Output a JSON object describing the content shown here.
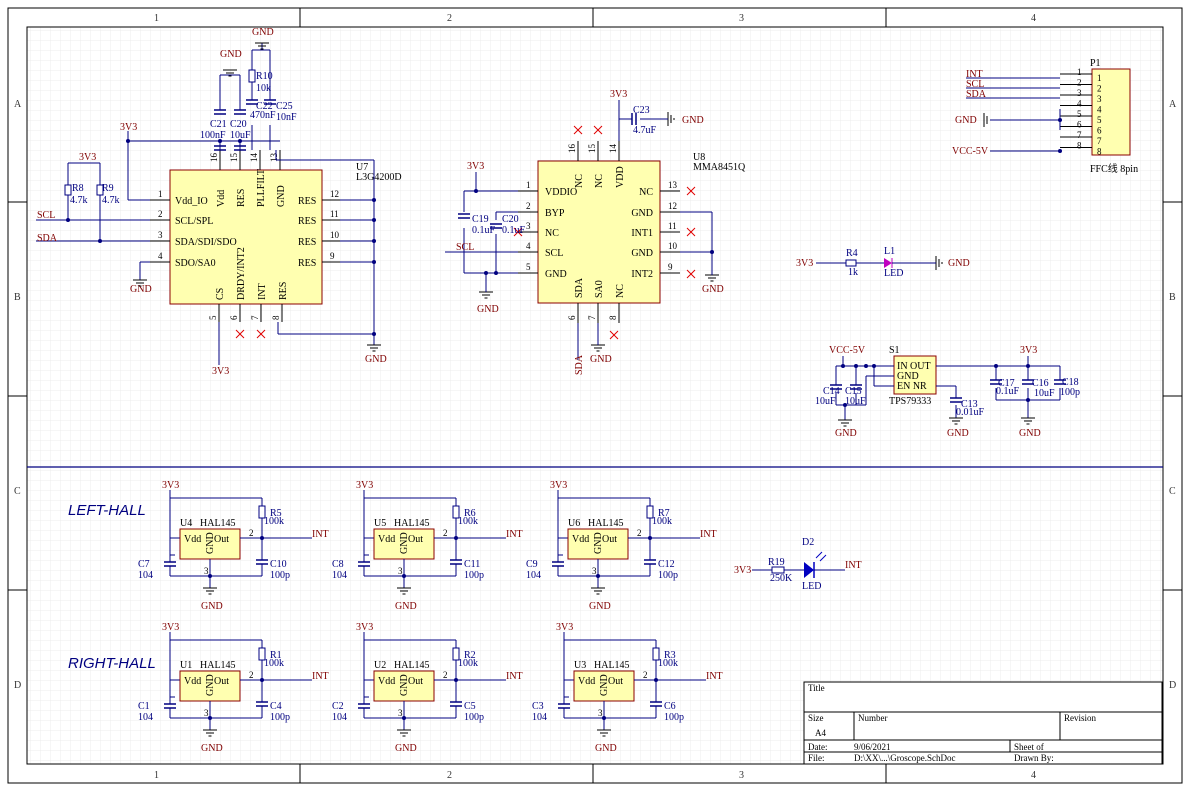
{
  "frame": {
    "cols": [
      "1",
      "2",
      "3",
      "4"
    ],
    "rows": [
      "A",
      "B",
      "C",
      "D"
    ]
  },
  "sections": {
    "left_hall": "LEFT-HALL",
    "right_hall": "RIGHT-HALL"
  },
  "nets": {
    "v3": "3V3",
    "gnd": "GND",
    "scl": "SCL",
    "sda": "SDA",
    "int": "INT",
    "vcc5": "VCC-5V"
  },
  "u7": {
    "ref": "U7",
    "part": "L3G4200D",
    "left_pins": [
      {
        "num": "1",
        "name": "Vdd_IO"
      },
      {
        "num": "2",
        "name": "SCL/SPL"
      },
      {
        "num": "3",
        "name": "SDA/SDI/SDO"
      },
      {
        "num": "4",
        "name": "SDO/SA0"
      }
    ],
    "right_pins": [
      {
        "num": "12",
        "name": "RES"
      },
      {
        "num": "11",
        "name": "RES"
      },
      {
        "num": "10",
        "name": "RES"
      },
      {
        "num": "9",
        "name": "RES"
      }
    ],
    "top_pins": [
      {
        "num": "16",
        "name": "Vdd"
      },
      {
        "num": "15",
        "name": "RES"
      },
      {
        "num": "14",
        "name": "PLLFILT"
      },
      {
        "num": "13",
        "name": "GND"
      }
    ],
    "bottom_pins": [
      {
        "num": "5",
        "name": "CS"
      },
      {
        "num": "6",
        "name": "DRDY/INT2"
      },
      {
        "num": "7",
        "name": "INT"
      },
      {
        "num": "8",
        "name": "RES"
      }
    ]
  },
  "u8": {
    "ref": "U8",
    "part": "MMA8451Q",
    "left_pins": [
      {
        "num": "1",
        "name": "VDDIO"
      },
      {
        "num": "2",
        "name": "BYP"
      },
      {
        "num": "3",
        "name": "NC"
      },
      {
        "num": "4",
        "name": "SCL"
      },
      {
        "num": "5",
        "name": "GND"
      }
    ],
    "right_pins": [
      {
        "num": "13",
        "name": "NC"
      },
      {
        "num": "12",
        "name": "GND"
      },
      {
        "num": "11",
        "name": "INT1"
      },
      {
        "num": "10",
        "name": "GND"
      },
      {
        "num": "9",
        "name": "INT2"
      }
    ],
    "top_pins": [
      {
        "num": "16",
        "name": "NC"
      },
      {
        "num": "15",
        "name": "NC"
      },
      {
        "num": "14",
        "name": "VDD"
      }
    ],
    "bottom_pins": [
      {
        "num": "6",
        "name": "SDA"
      },
      {
        "num": "7",
        "name": "SA0"
      },
      {
        "num": "8",
        "name": "NC"
      }
    ]
  },
  "passives": {
    "r8": {
      "ref": "R8",
      "val": "4.7k"
    },
    "r9": {
      "ref": "R9",
      "val": "4.7k"
    },
    "r10": {
      "ref": "R10",
      "val": "10k"
    },
    "c21": {
      "ref": "C21",
      "val": "100nF"
    },
    "c20": {
      "ref": "C20",
      "val": "10uF"
    },
    "c22": {
      "ref": "C22",
      "val": "470nF"
    },
    "c25": {
      "ref": "C25",
      "val": "10nF"
    },
    "c23": {
      "ref": "C23",
      "val": "4.7uF"
    },
    "c19": {
      "ref": "C19",
      "val": "0.1uF"
    },
    "c20b": {
      "ref": "C20",
      "val": "0.1uF"
    },
    "r4": {
      "ref": "R4",
      "val": "1k"
    },
    "l1": {
      "ref": "L1",
      "val": "LED"
    },
    "c14": {
      "ref": "C14",
      "val": "10uF"
    },
    "c15": {
      "ref": "C15",
      "val": "10uF"
    },
    "c13": {
      "ref": "C13",
      "val": "0.01uF"
    },
    "c17": {
      "ref": "C17",
      "val": "0.1uF"
    },
    "c16": {
      "ref": "C16",
      "val": "10uF"
    },
    "c18": {
      "ref": "C18",
      "val": "100p"
    },
    "r19": {
      "ref": "R19",
      "val": "250K"
    },
    "d2": {
      "ref": "D2",
      "val": "LED"
    }
  },
  "s1": {
    "ref": "S1",
    "part": "TPS79333",
    "pins": [
      "IN OUT",
      "GND",
      "EN  NR"
    ]
  },
  "p1": {
    "ref": "P1",
    "part": "FFC线 8pin",
    "nets": [
      "INT",
      "SCL",
      "SDA",
      "",
      "GND",
      "",
      "",
      "VCC-5V"
    ],
    "pins": [
      "1",
      "2",
      "3",
      "4",
      "5",
      "6",
      "7",
      "8"
    ]
  },
  "halls": [
    {
      "u": "U4",
      "r": "R5",
      "c1": "C7",
      "c2": "C10"
    },
    {
      "u": "U5",
      "r": "R6",
      "c1": "C8",
      "c2": "C11"
    },
    {
      "u": "U6",
      "r": "R7",
      "c1": "C9",
      "c2": "C12"
    },
    {
      "u": "U1",
      "r": "R1",
      "c1": "C1",
      "c2": "C4"
    },
    {
      "u": "U2",
      "r": "R2",
      "c1": "C2",
      "c2": "C5"
    },
    {
      "u": "U3",
      "r": "R3",
      "c1": "C3",
      "c2": "C6"
    }
  ],
  "hall_common": {
    "part": "HAL145",
    "pin_vdd": "Vdd",
    "pin_gnd": "GND",
    "pin_out": "Out",
    "r_val": "100k",
    "c1_val": "104",
    "c2_val": "100p",
    "pin2": "2",
    "pin3": "3"
  },
  "titleblock": {
    "title_label": "Title",
    "size_label": "Size",
    "size_value": "A4",
    "number_label": "Number",
    "revision_label": "Revision",
    "date_label": "Date:",
    "date_value": "9/06/2021",
    "file_label": "File:",
    "file_value": "D:\\XX\\...\\Groscope.SchDoc",
    "sheet_label": "Sheet   of",
    "drawn_label": "Drawn By:"
  }
}
